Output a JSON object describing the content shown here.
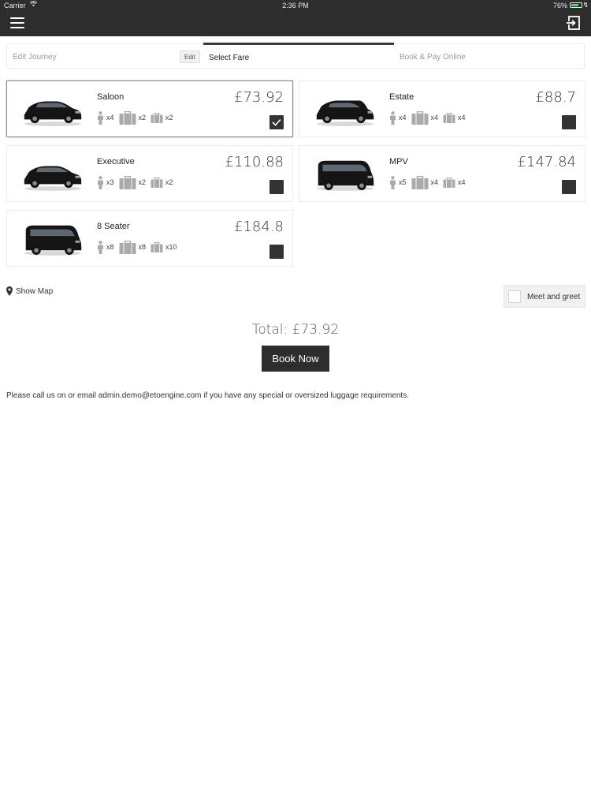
{
  "status_bar": {
    "carrier": "Carrier",
    "time": "2:36 PM",
    "battery": "76%",
    "battery_level": 0.76
  },
  "nav": {
    "menu_icon": "hamburger-menu-icon",
    "exit_icon": "sign-out-icon"
  },
  "steps": {
    "edit_journey": "Edit Journey",
    "edit_button": "Edit",
    "select_fare": "Select Fare",
    "book_pay": "Book & Pay Online"
  },
  "vehicles": [
    {
      "name": "Saloon",
      "price": "£73.92",
      "passengers": "x4",
      "luggage": "x2",
      "hand_luggage": "x2",
      "selected": true
    },
    {
      "name": "Estate",
      "price": "£88.7",
      "passengers": "x4",
      "luggage": "x4",
      "hand_luggage": "x4",
      "selected": false
    },
    {
      "name": "Executive",
      "price": "£110.88",
      "passengers": "x3",
      "luggage": "x2",
      "hand_luggage": "x2",
      "selected": false
    },
    {
      "name": "MPV",
      "price": "£147.84",
      "passengers": "x5",
      "luggage": "x4",
      "hand_luggage": "x4",
      "selected": false
    },
    {
      "name": "8 Seater",
      "price": "£184.8",
      "passengers": "x8",
      "luggage": "x8",
      "hand_luggage": "x10",
      "selected": false
    }
  ],
  "show_map": "Show Map",
  "meet_and_greet": {
    "label": "Meet and greet",
    "checked": false
  },
  "total": "Total: £73.92",
  "book_now": "Book Now",
  "note": "Please call us on or email admin.demo@etoengine.com if you have any special or oversized luggage requirements.",
  "colors": {
    "header": "#2d2d2d",
    "accent": "#333333",
    "battery": "#4cd964"
  }
}
